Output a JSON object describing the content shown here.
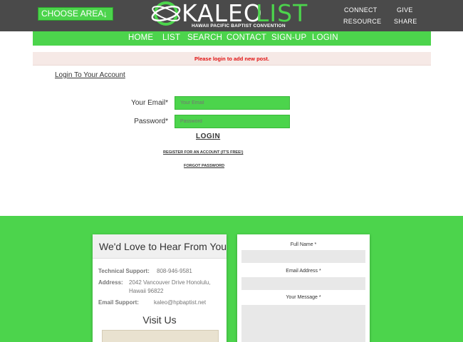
{
  "header": {
    "choose_area": "CHOOSE AREA",
    "choose_arrow": "↓",
    "logo_kaleo": "KALEO",
    "logo_list": "LIST",
    "tagline": "HAWAII PACIFIC BAPTIST CONVENTION",
    "links": {
      "connect": "CONNECT",
      "give": "GIVE",
      "resource": "RESOURCE",
      "share": "SHARE"
    }
  },
  "nav": {
    "home": "HOME",
    "list": "LIST",
    "search": "SEARCH",
    "contact": "CONTACT",
    "signup": "SIGN-UP",
    "login": "LOGIN"
  },
  "notice": "Please login to add new post.",
  "login": {
    "title": "Login To Your Account",
    "email_label": "Your Email*",
    "email_placeholder": "Your Email",
    "password_label": "Password*",
    "password_placeholder": "Password",
    "button": "LOGIN",
    "register": "REGISTER FOR AN ACCOUNT (IT'S FREE!)",
    "forgot": "FORGOT PASSWORD"
  },
  "footer": {
    "contact_title": "We'd Love to Hear From You",
    "tech_label": "Technical Support:",
    "tech_value": "808-946-9581",
    "address_label": "Address:",
    "address_line1": "2042 Vancouver Drive Honolulu,",
    "address_line2": "Hawaii 96822",
    "email_label": "Email Support:",
    "email_value": "kaleo@hpbaptist.net",
    "visit": "Visit Us",
    "form": {
      "full_name": "Full Name *",
      "email": "Email Address *",
      "message": "Your Message *"
    }
  },
  "colors": {
    "green": "#4cd44c",
    "header_gray": "#4a4a4a",
    "notice_red": "#e01010",
    "notice_bg": "#f6e9e6"
  }
}
